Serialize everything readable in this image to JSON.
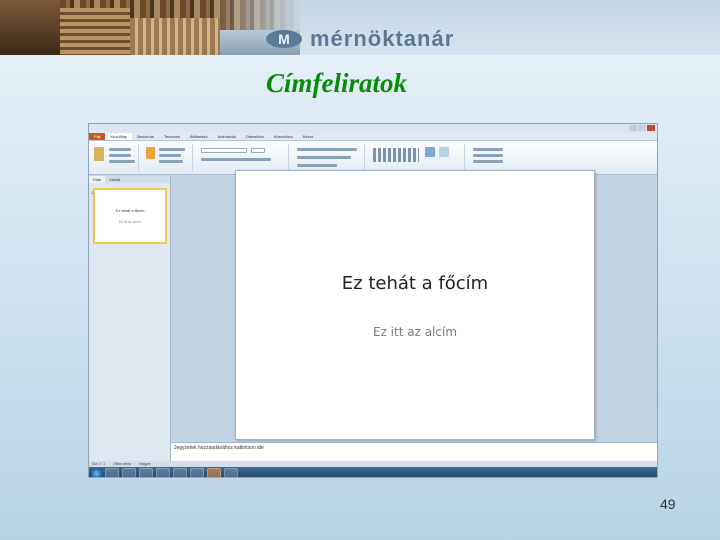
{
  "banner": {
    "logo_text": "mérnöktanár"
  },
  "slide_title": "Címfeliratok",
  "app": {
    "window_title": "",
    "file_tab": "Fájl",
    "tabs": [
      "Kezdőlap",
      "Beszúrás",
      "Tervezés",
      "Áttűnések",
      "Animációk",
      "Diavetítés",
      "Korrektúra",
      "Nézet"
    ],
    "pane_tabs": [
      "Diák",
      "Vázlat"
    ],
    "thumbnail": {
      "number": "1",
      "title": "Ez tehát a főcím",
      "subtitle": "Ez itt az alcím"
    },
    "slide": {
      "title": "Ez tehát a főcím",
      "subtitle": "Ez itt az alcím"
    },
    "notes": "Jegyzetek hozzáadásához kattintson ide",
    "status": [
      "Dia 1 / 1",
      "Office-téma",
      "magyar"
    ],
    "tray_time": "",
    "colors": {
      "file_tab": "#c55a1d",
      "taskbar": "#1f4466",
      "thumb_border": "#f2c94c"
    }
  },
  "page_number": "49"
}
